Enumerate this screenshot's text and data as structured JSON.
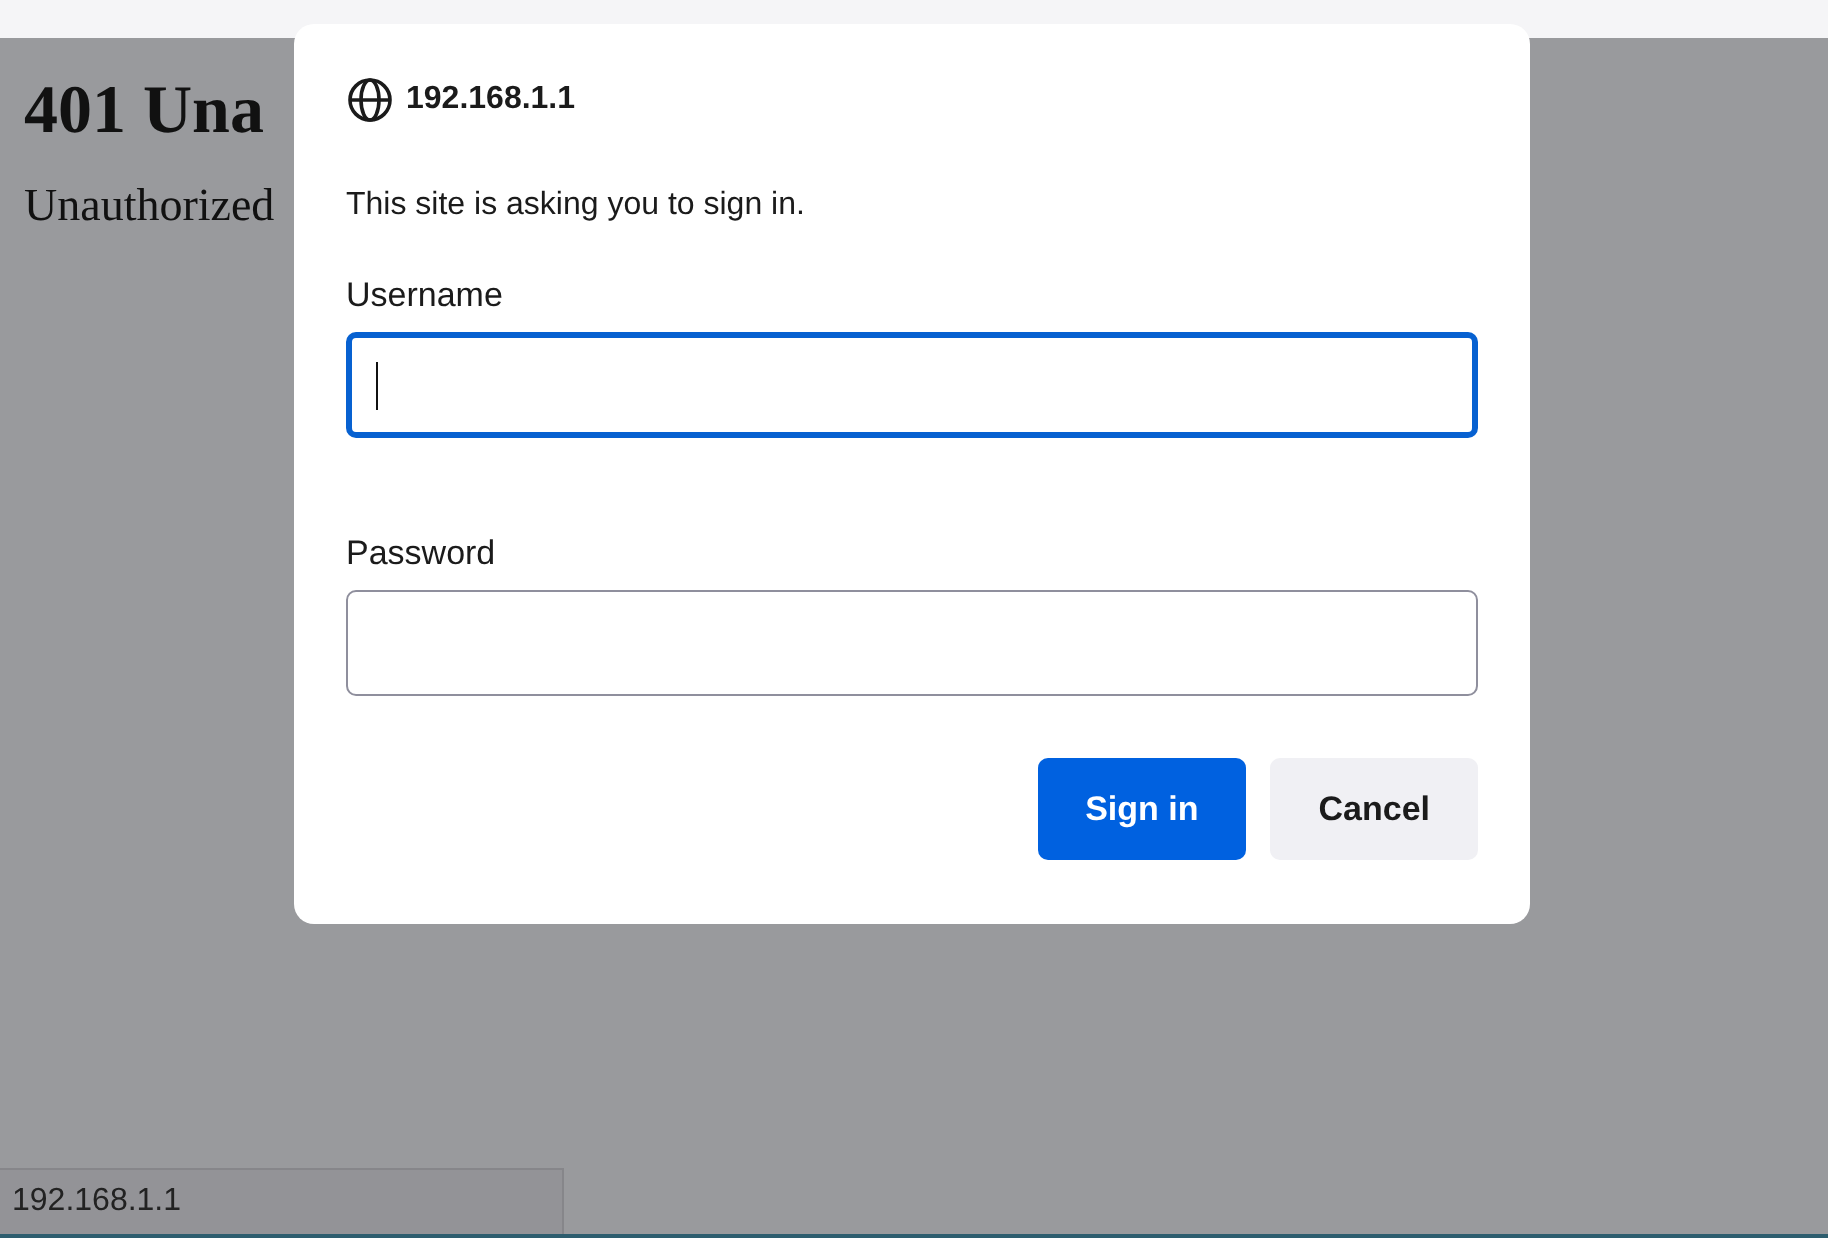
{
  "page": {
    "heading": "401 Una",
    "message": "Unauthorized"
  },
  "dialog": {
    "host": "192.168.1.1",
    "prompt": "This site is asking you to sign in.",
    "fields": [
      {
        "label": "Username",
        "focused": true
      },
      {
        "label": "Password",
        "focused": false
      }
    ],
    "buttons": [
      {
        "label": "Sign in",
        "kind": "primary"
      },
      {
        "label": "Cancel",
        "kind": "secondary"
      }
    ]
  },
  "status_bar": {
    "url": "192.168.1.1"
  }
}
